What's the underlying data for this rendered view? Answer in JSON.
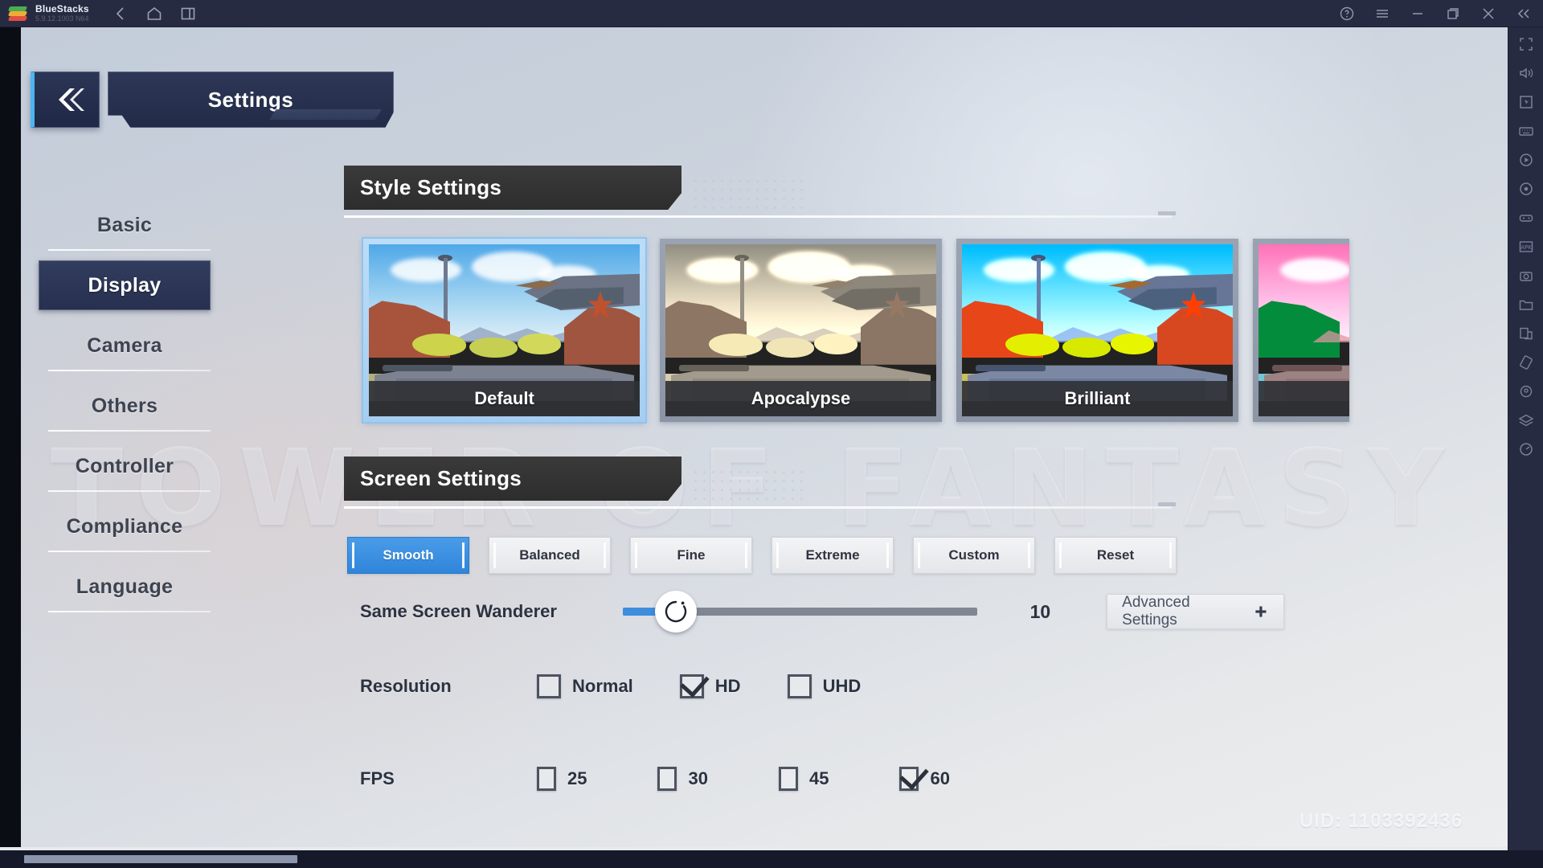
{
  "titlebar": {
    "app_name": "BlueStacks",
    "version": "5.9.12.1003 N64",
    "nav": [
      {
        "name": "back",
        "icon": "arrow-left-icon"
      },
      {
        "name": "home",
        "icon": "home-icon"
      },
      {
        "name": "multi-window",
        "icon": "window-icon"
      }
    ],
    "controls": [
      {
        "name": "help",
        "icon": "help-circle-icon"
      },
      {
        "name": "menu",
        "icon": "hamburger-menu-icon"
      },
      {
        "name": "minimize",
        "icon": "minimize-icon"
      },
      {
        "name": "maximize",
        "icon": "maximize-icon"
      },
      {
        "name": "close",
        "icon": "close-icon"
      },
      {
        "name": "collapse-sidebar",
        "icon": "chevron-double-left-icon"
      }
    ]
  },
  "right_sidebar": {
    "items": [
      {
        "name": "fullscreen",
        "icon": "fullscreen-icon"
      },
      {
        "name": "volume",
        "icon": "volume-icon"
      },
      {
        "name": "cursor-lock",
        "icon": "cursor-icon"
      },
      {
        "name": "keyboard-controls",
        "icon": "keyboard-icon"
      },
      {
        "name": "macro-recorder",
        "icon": "play-circle-icon"
      },
      {
        "name": "screen-record",
        "icon": "record-circle-icon"
      },
      {
        "name": "game-controls",
        "icon": "gamepad-icon"
      },
      {
        "name": "install-apk",
        "icon": "apk-plus-icon"
      },
      {
        "name": "screenshot",
        "icon": "camera-icon"
      },
      {
        "name": "media-manager",
        "icon": "folder-icon"
      },
      {
        "name": "multi-instance",
        "icon": "copy-icon"
      },
      {
        "name": "rotate",
        "icon": "rotate-icon"
      },
      {
        "name": "location",
        "icon": "location-pin-icon"
      },
      {
        "name": "layers",
        "icon": "layers-icon"
      },
      {
        "name": "performance",
        "icon": "speedometer-icon"
      }
    ]
  },
  "game": {
    "watermark": "TOWER OF FANTASY",
    "uid": "UID: 1103392436",
    "header": {
      "title": "Settings",
      "back_icon": "chevron-double-left-icon"
    },
    "left_nav": {
      "items": [
        {
          "label": "Basic",
          "active": false
        },
        {
          "label": "Display",
          "active": true
        },
        {
          "label": "Camera",
          "active": false
        },
        {
          "label": "Others",
          "active": false
        },
        {
          "label": "Controller",
          "active": false
        },
        {
          "label": "Compliance",
          "active": false
        },
        {
          "label": "Language",
          "active": false
        }
      ]
    },
    "style_settings": {
      "title": "Style Settings",
      "cards": [
        {
          "label": "Default",
          "selected": true,
          "style": "default"
        },
        {
          "label": "Apocalypse",
          "selected": false,
          "style": "apocalypse"
        },
        {
          "label": "Brilliant",
          "selected": false,
          "style": "brilliant"
        },
        {
          "label": "",
          "selected": false,
          "style": "teal"
        }
      ]
    },
    "screen_settings": {
      "title": "Screen Settings",
      "presets": [
        {
          "label": "Smooth",
          "selected": true
        },
        {
          "label": "Balanced",
          "selected": false
        },
        {
          "label": "Fine",
          "selected": false
        },
        {
          "label": "Extreme",
          "selected": false
        },
        {
          "label": "Custom",
          "selected": false
        },
        {
          "label": "Reset",
          "selected": false
        }
      ],
      "wanderer": {
        "label": "Same Screen Wanderer",
        "value": "10",
        "percent": 15
      },
      "advanced_button": {
        "label": "Advanced Settings",
        "icon": "plus-icon"
      },
      "resolution": {
        "label": "Resolution",
        "options": [
          {
            "label": "Normal",
            "checked": false
          },
          {
            "label": "HD",
            "checked": true
          },
          {
            "label": "UHD",
            "checked": false
          }
        ]
      },
      "fps": {
        "label": "FPS",
        "options": [
          {
            "label": "25",
            "checked": false
          },
          {
            "label": "30",
            "checked": false
          },
          {
            "label": "45",
            "checked": false
          },
          {
            "label": "60",
            "checked": true
          }
        ]
      }
    }
  },
  "colors": {
    "accent_blue": "#3f8ddd",
    "titlebar_bg": "#262b42",
    "panel_dark": "#2d3350",
    "selected_card_border": "#a6cdf0"
  }
}
